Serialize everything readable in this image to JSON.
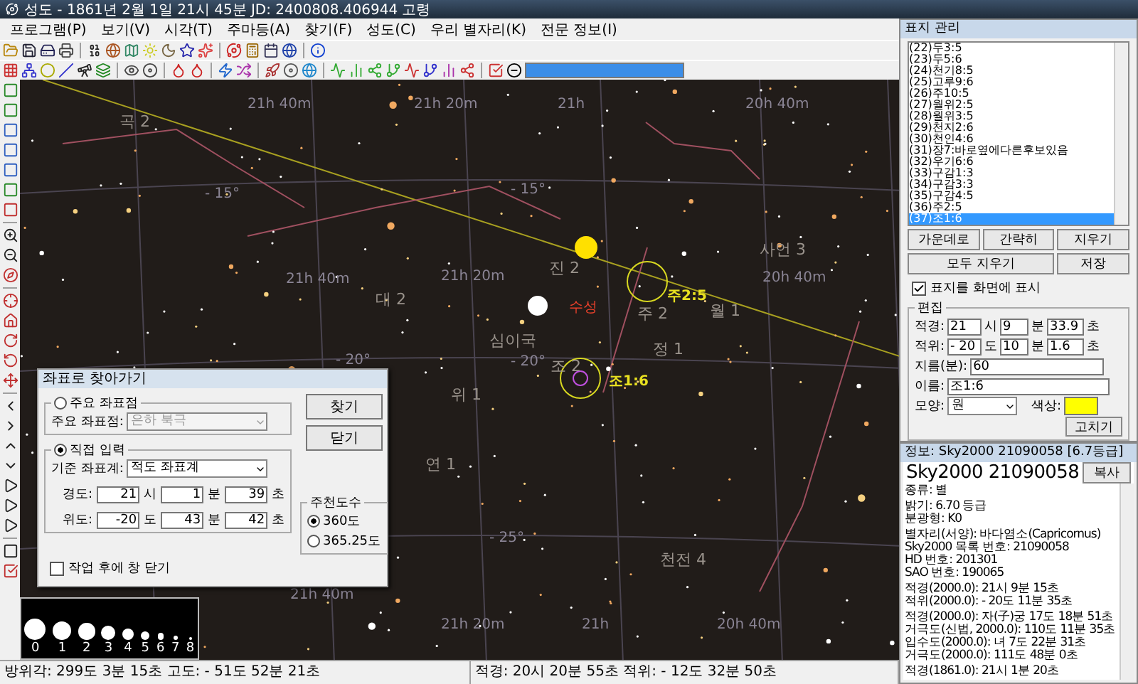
{
  "window": {
    "title": "성도 -  1861년 2월 1일  21시 45분 JD: 2400808.406944  고령"
  },
  "menu": [
    "프로그램(P)",
    "보기(V)",
    "시각(T)",
    "주마등(A)",
    "찾기(F)",
    "성도(C)",
    "우리 별자리(K)",
    "전문 정보(I)"
  ],
  "zoom_slider": {
    "level": 1
  },
  "sky_labels": [
    {
      "text": "곡 2",
      "kind": "constellation"
    },
    {
      "text": "21h 40m",
      "kind": "grid"
    },
    {
      "text": "21h 20m",
      "kind": "grid"
    },
    {
      "text": "21h",
      "kind": "grid"
    },
    {
      "text": "20h 40m",
      "kind": "grid"
    },
    {
      "text": "- 15°",
      "kind": "grid"
    },
    {
      "text": "- 15°",
      "kind": "grid"
    },
    {
      "text": "대 2",
      "kind": "constellation"
    },
    {
      "text": "진 2",
      "kind": "constellation"
    },
    {
      "text": "21h 40m",
      "kind": "grid"
    },
    {
      "text": "21h 20m",
      "kind": "grid"
    },
    {
      "text": "사언 3",
      "kind": "constellation"
    },
    {
      "text": "20h 40m",
      "kind": "grid"
    },
    {
      "text": "수성",
      "kind": "planet"
    },
    {
      "text": "주2:5",
      "kind": "marker"
    },
    {
      "text": "주 2",
      "kind": "constellation"
    },
    {
      "text": "월 1",
      "kind": "constellation"
    },
    {
      "text": "정 1",
      "kind": "constellation"
    },
    {
      "text": "심이국",
      "kind": "constellation"
    },
    {
      "text": "- 20°",
      "kind": "grid"
    },
    {
      "text": "- 20°",
      "kind": "grid"
    },
    {
      "text": "조 2",
      "kind": "constellation"
    },
    {
      "text": "조1:6",
      "kind": "marker"
    },
    {
      "text": "위 1",
      "kind": "constellation"
    },
    {
      "text": "연 1",
      "kind": "constellation"
    },
    {
      "text": "- 25°",
      "kind": "grid"
    },
    {
      "text": "천전 4",
      "kind": "constellation"
    },
    {
      "text": "21h 40m",
      "kind": "grid"
    },
    {
      "text": "21h 20m",
      "kind": "grid"
    },
    {
      "text": "21h",
      "kind": "grid"
    },
    {
      "text": "20h 40m",
      "kind": "grid"
    }
  ],
  "magnitude_legend": [
    "0",
    "1",
    "2",
    "3",
    "4",
    "5",
    "6",
    "7",
    "8"
  ],
  "dialog": {
    "title": "좌표로 찾아가기",
    "preset": {
      "label": "주요 좌표점",
      "selected": false,
      "field_label": "주요 좌표점:",
      "value": "은하 북극"
    },
    "manual": {
      "label": "직접 입력",
      "selected": true,
      "field_label": "기준 좌표계:",
      "value": "적도 좌표계",
      "rows": [
        {
          "label": "경도:",
          "parts": [
            {
              "value": "21",
              "unit": "시"
            },
            {
              "value": "1",
              "unit": "분"
            },
            {
              "value": "39",
              "unit": "초"
            }
          ]
        },
        {
          "label": "위도:",
          "parts": [
            {
              "value": "-20",
              "unit": "도"
            },
            {
              "value": "43",
              "unit": "분"
            },
            {
              "value": "42",
              "unit": "초"
            }
          ]
        }
      ]
    },
    "buttons": [
      "찾기",
      "닫기"
    ],
    "degree_group": {
      "label": "주천도수",
      "options": [
        {
          "label": "360도",
          "selected": true
        },
        {
          "label": "365.25도",
          "selected": false
        }
      ]
    },
    "close_after": {
      "label": "작업 후에 창 닫기",
      "checked": false
    }
  },
  "status_bar": {
    "left": "방위각: 299도  3분  15초 고도: - 51도  52분  21초",
    "right": "적경:  20시  20분  55초 적위: - 12도  32분  50초"
  },
  "marker_panel": {
    "title": "표지 관리",
    "items": [
      {
        "label": "(22)두3:5",
        "selected": false
      },
      {
        "label": "(23)두5:6",
        "selected": false
      },
      {
        "label": "(24)천기8:5",
        "selected": false
      },
      {
        "label": "(25)고루9:6",
        "selected": false
      },
      {
        "label": "(26)주10:5",
        "selected": false
      },
      {
        "label": "(27)월위2:5",
        "selected": false
      },
      {
        "label": "(28)월위3:5",
        "selected": false
      },
      {
        "label": "(29)천지2:6",
        "selected": false
      },
      {
        "label": "(30)천인4:6",
        "selected": false
      },
      {
        "label": "(31)장7:바로옆에다른후보있음",
        "selected": false
      },
      {
        "label": "(32)우기6:6",
        "selected": false
      },
      {
        "label": "(33)구감1:3",
        "selected": false
      },
      {
        "label": "(34)구감3:3",
        "selected": false
      },
      {
        "label": "(35)구감4:5",
        "selected": false
      },
      {
        "label": "(36)주2:5",
        "selected": false
      },
      {
        "label": "(37)조1:6",
        "selected": true
      }
    ],
    "buttons": [
      "가운데로",
      "간략히",
      "지우기",
      "모두 지우기",
      "저장"
    ],
    "show_on_screen": {
      "label": "표지를 화면에 표시",
      "checked": true
    },
    "edit": {
      "title": "편집",
      "ra": {
        "label": "적경:",
        "parts": [
          {
            "value": "21",
            "unit": "시"
          },
          {
            "value": "9",
            "unit": "분"
          },
          {
            "value": "33.9",
            "unit": "초"
          }
        ]
      },
      "dec": {
        "label": "적위:",
        "parts": [
          {
            "value": "- 20",
            "unit": "도"
          },
          {
            "value": "10",
            "unit": "분"
          },
          {
            "value": "1.6",
            "unit": "초"
          }
        ]
      },
      "diameter": {
        "label": "지름(분):",
        "value": "60"
      },
      "name": {
        "label": "이름:",
        "value": "조1:6"
      },
      "shape": {
        "label": "모양:",
        "value": "원"
      },
      "color": {
        "label": "색상:",
        "color": "#ffff00"
      },
      "apply": "고치기"
    }
  },
  "info_panel": {
    "title": "정보: Sky2000 21090058 [6.7등급]",
    "heading": "Sky2000 21090058",
    "copy": "복사",
    "paragraphs": [
      [
        "종류: 별"
      ],
      [
        "밝기: 6.70 등급",
        "분광형: K0"
      ],
      [
        "별자리(서양): 바다염소(Capricornus)",
        "Sky2000 목록 번호: 21090058",
        "HD 번호: 201301",
        "SAO 번호: 190065"
      ],
      [
        "적경(2000.0): 21시  9분  15초",
        "적위(2000.0): - 20도  11분  35초"
      ],
      [
        "적경(2000.0): 자(子)궁 17도  18분  51초",
        "거극도(신법, 2000.0): 110도  11분  35초",
        "입수도(2000.0): 녀 7도  22분  31초",
        "거극도(2000.0): 111도  48분  0초"
      ],
      [
        "적경(1861.0): 21시  1분  20초"
      ]
    ]
  }
}
